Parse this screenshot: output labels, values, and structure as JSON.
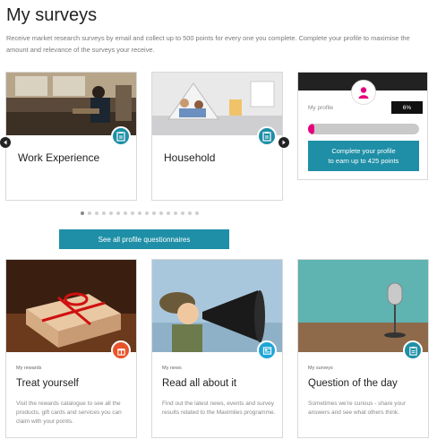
{
  "page": {
    "title": "My surveys",
    "intro": "Receive market research surveys by email and collect up to 500 points for every one you complete. Complete your profile to maximise the amount and relevance of the surveys your receive."
  },
  "carousel": {
    "cards": [
      {
        "label": "Work Experience",
        "icon": "clipboard-icon"
      },
      {
        "label": "Household",
        "icon": "clipboard-icon"
      }
    ],
    "dots_total": 17,
    "active_dot": 0
  },
  "profile": {
    "label": "My profile",
    "percent_text": "6%",
    "percent": 0.06,
    "cta_line1": "Complete your profile",
    "cta_line2": "to earn up to 425 points"
  },
  "see_all_label": "See all profile questionnaires",
  "bottom_cards": [
    {
      "category": "My rewards",
      "title": "Treat yourself",
      "desc": "Visit the rewards catalogue to see all the products, gift cards and services you can claim with your points.",
      "badge_color": "#e8542b",
      "icon": "gift-icon"
    },
    {
      "category": "My news",
      "title": "Read all about it",
      "desc": "Find out the latest news, events and survey results related to the Maximiles programme.",
      "badge_color": "#1da6d8",
      "icon": "newspaper-icon"
    },
    {
      "category": "My surveys",
      "title": "Question of the day",
      "desc": "Sometimes we're curious - share your answers and see what others think.",
      "badge_color": "#1e8fa6",
      "icon": "clipboard-icon"
    }
  ],
  "colors": {
    "accent": "#1e8fa6",
    "profile_fill": "#e6007e"
  }
}
